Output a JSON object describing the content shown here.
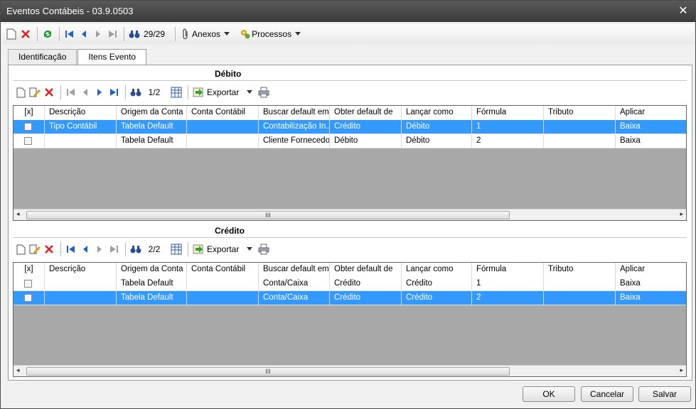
{
  "window": {
    "title": "Eventos Contábeis - 03.9.0503",
    "close_glyph": "✕"
  },
  "toolbar": {
    "record_counter": "29/29",
    "attachments_label": "Anexos",
    "processes_label": "Processos"
  },
  "tabs": [
    {
      "label": "Identificação"
    },
    {
      "label": "Itens Evento"
    }
  ],
  "columns": [
    "[x]",
    "Descrição",
    "Origem da Conta",
    "Conta Contábil",
    "Buscar default em",
    "Obter default de",
    "Lançar como",
    "Fórmula",
    "Tributo",
    "Aplicar"
  ],
  "debit": {
    "title": "Débito",
    "counter": "1/2",
    "export_label": "Exportar",
    "rows": [
      {
        "descricao": "Tipo Contábil",
        "origem": "Tabela Default",
        "conta": "",
        "buscar": "Contabilização In...",
        "obter": "Crédito",
        "lancar": "Débito",
        "formula": "1",
        "tributo": "",
        "aplicar": "Baixa"
      },
      {
        "descricao": "",
        "origem": "Tabela Default",
        "conta": "",
        "buscar": "Cliente Fornecedor",
        "obter": "Débito",
        "lancar": "Débito",
        "formula": "2",
        "tributo": "",
        "aplicar": "Baixa"
      }
    ]
  },
  "credit": {
    "title": "Crédito",
    "counter": "2/2",
    "export_label": "Exportar",
    "rows": [
      {
        "descricao": "",
        "origem": "Tabela Default",
        "conta": "",
        "buscar": "Conta/Caixa",
        "obter": "Crédito",
        "lancar": "Crédito",
        "formula": "1",
        "tributo": "",
        "aplicar": "Baixa"
      },
      {
        "descricao": "",
        "origem": "Tabela Default",
        "conta": "",
        "buscar": "Conta/Caixa",
        "obter": "Crédito",
        "lancar": "Crédito",
        "formula": "2",
        "tributo": "",
        "aplicar": "Baixa"
      }
    ]
  },
  "scroll_thumb_glyph": "III",
  "buttons": {
    "ok": "OK",
    "cancel": "Cancelar",
    "save": "Salvar"
  },
  "colors": {
    "selection": "#3399ff",
    "delete": "#e02020",
    "nav": "#2060d0"
  }
}
